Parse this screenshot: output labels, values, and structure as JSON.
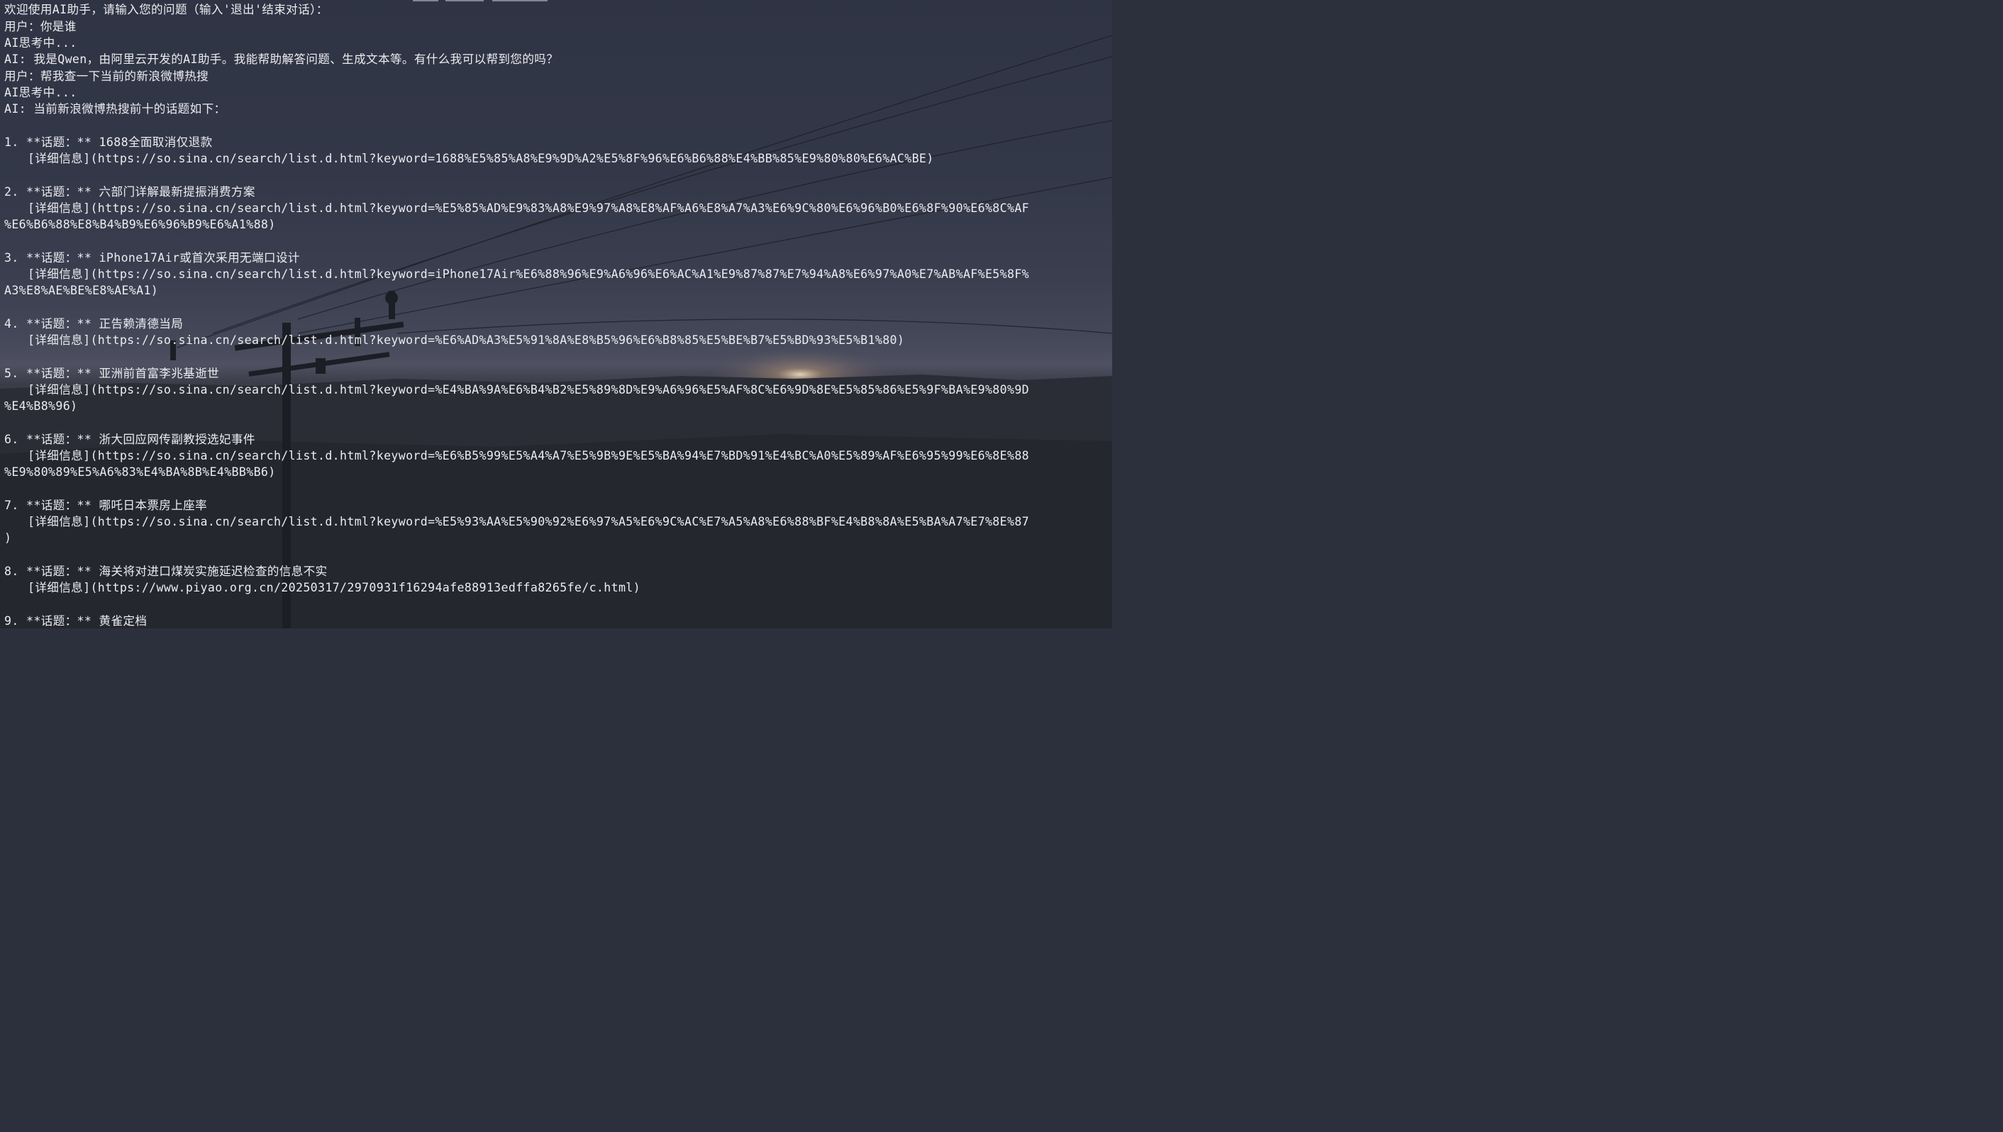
{
  "terminal": {
    "welcome": "欢迎使用AI助手，请输入您的问题（输入'退出'结束对话）：",
    "q1": "用户：你是谁",
    "thinking1": "AI思考中...",
    "a1": "AI: 我是Qwen，由阿里云开发的AI助手。我能帮助解答问题、生成文本等。有什么我可以帮到您的吗？",
    "q2": "用户：帮我查一下当前的新浪微博热搜",
    "thinking2": "AI思考中...",
    "a2": "AI: 当前新浪微博热搜前十的话题如下：",
    "topics": [
      {
        "title": "1. **话题：** 1688全面取消仅退款",
        "link": "[详细信息](https://so.sina.cn/search/list.d.html?keyword=1688%E5%85%A8%E9%9D%A2%E5%8F%96%E6%B6%88%E4%BB%85%E9%80%80%E6%AC%BE)",
        "wrap": ""
      },
      {
        "title": "2. **话题：** 六部门详解最新提振消费方案",
        "link": "[详细信息](https://so.sina.cn/search/list.d.html?keyword=%E5%85%AD%E9%83%A8%E9%97%A8%E8%AF%A6%E8%A7%A3%E6%9C%80%E6%96%B0%E6%8F%90%E6%8C%AF",
        "wrap": "%E6%B6%88%E8%B4%B9%E6%96%B9%E6%A1%88)"
      },
      {
        "title": "3. **话题：** iPhone17Air或首次采用无端口设计",
        "link": "[详细信息](https://so.sina.cn/search/list.d.html?keyword=iPhone17Air%E6%88%96%E9%A6%96%E6%AC%A1%E9%87%87%E7%94%A8%E6%97%A0%E7%AB%AF%E5%8F%",
        "wrap": "A3%E8%AE%BE%E8%AE%A1)"
      },
      {
        "title": "4. **话题：** 正告赖清德当局",
        "link": "[详细信息](https://so.sina.cn/search/list.d.html?keyword=%E6%AD%A3%E5%91%8A%E8%B5%96%E6%B8%85%E5%BE%B7%E5%BD%93%E5%B1%80)",
        "wrap": ""
      },
      {
        "title": "5. **话题：** 亚洲前首富李兆基逝世",
        "link": "[详细信息](https://so.sina.cn/search/list.d.html?keyword=%E4%BA%9A%E6%B4%B2%E5%89%8D%E9%A6%96%E5%AF%8C%E6%9D%8E%E5%85%86%E5%9F%BA%E9%80%9D",
        "wrap": "%E4%B8%96)"
      },
      {
        "title": "6. **话题：** 浙大回应网传副教授选妃事件",
        "link": "[详细信息](https://so.sina.cn/search/list.d.html?keyword=%E6%B5%99%E5%A4%A7%E5%9B%9E%E5%BA%94%E7%BD%91%E4%BC%A0%E5%89%AF%E6%95%99%E6%8E%88",
        "wrap": "%E9%80%89%E5%A6%83%E4%BA%8B%E4%BB%B6)"
      },
      {
        "title": "7. **话题：** 哪吒日本票房上座率",
        "link": "[详细信息](https://so.sina.cn/search/list.d.html?keyword=%E5%93%AA%E5%90%92%E6%97%A5%E6%9C%AC%E7%A5%A8%E6%88%BF%E4%B8%8A%E5%BA%A7%E7%8E%87",
        "wrap": ")"
      },
      {
        "title": "8. **话题：** 海关将对进口煤炭实施延迟检查的信息不实",
        "link": "[详细信息](https://www.piyao.org.cn/20250317/2970931f16294afe88913edffa8265fe/c.html)",
        "wrap": ""
      },
      {
        "title": "9. **话题：** 黄雀定档",
        "link": "",
        "wrap": ""
      }
    ]
  }
}
